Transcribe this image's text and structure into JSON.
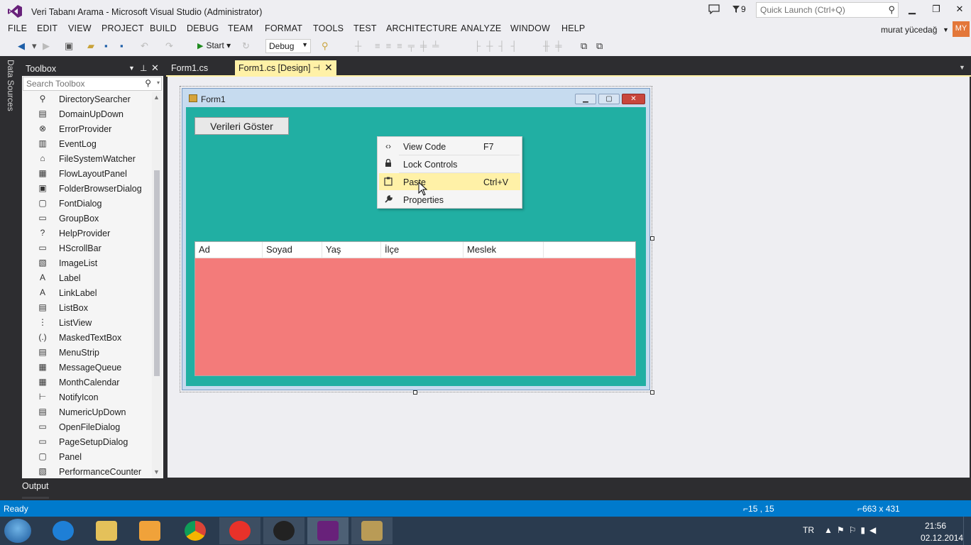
{
  "window": {
    "title": "Veri Tabanı Arama - Microsoft Visual Studio (Administrator)",
    "notification_count": "9",
    "quick_launch_placeholder": "Quick Launch (Ctrl+Q)"
  },
  "menu": {
    "items": [
      "FILE",
      "EDIT",
      "VIEW",
      "PROJECT",
      "BUILD",
      "DEBUG",
      "TEAM",
      "FORMAT",
      "TOOLS",
      "TEST",
      "ARCHITECTURE",
      "ANALYZE",
      "WINDOW",
      "HELP"
    ]
  },
  "user": {
    "name": "murat yücedağ",
    "initials": "MY"
  },
  "toolbar": {
    "start_label": "Start",
    "config_value": "Debug"
  },
  "side_strip": {
    "data_sources": "Data Sources"
  },
  "toolbox": {
    "title": "Toolbox",
    "search_placeholder": "Search Toolbox",
    "items": [
      {
        "label": "DirectorySearcher",
        "icon": "magnifier-icon"
      },
      {
        "label": "DomainUpDown",
        "icon": "updown-icon"
      },
      {
        "label": "ErrorProvider",
        "icon": "error-icon"
      },
      {
        "label": "EventLog",
        "icon": "eventlog-icon"
      },
      {
        "label": "FileSystemWatcher",
        "icon": "watcher-icon"
      },
      {
        "label": "FlowLayoutPanel",
        "icon": "flowlayout-icon"
      },
      {
        "label": "FolderBrowserDialog",
        "icon": "folder-icon"
      },
      {
        "label": "FontDialog",
        "icon": "font-icon"
      },
      {
        "label": "GroupBox",
        "icon": "groupbox-icon"
      },
      {
        "label": "HelpProvider",
        "icon": "help-icon"
      },
      {
        "label": "HScrollBar",
        "icon": "hscroll-icon"
      },
      {
        "label": "ImageList",
        "icon": "imagelist-icon"
      },
      {
        "label": "Label",
        "icon": "label-icon"
      },
      {
        "label": "LinkLabel",
        "icon": "linklabel-icon"
      },
      {
        "label": "ListBox",
        "icon": "listbox-icon"
      },
      {
        "label": "ListView",
        "icon": "listview-icon"
      },
      {
        "label": "MaskedTextBox",
        "icon": "masked-icon"
      },
      {
        "label": "MenuStrip",
        "icon": "menustrip-icon"
      },
      {
        "label": "MessageQueue",
        "icon": "queue-icon"
      },
      {
        "label": "MonthCalendar",
        "icon": "calendar-icon"
      },
      {
        "label": "NotifyIcon",
        "icon": "notify-icon"
      },
      {
        "label": "NumericUpDown",
        "icon": "numeric-icon"
      },
      {
        "label": "OpenFileDialog",
        "icon": "openfile-icon"
      },
      {
        "label": "PageSetupDialog",
        "icon": "pagesetup-icon"
      },
      {
        "label": "Panel",
        "icon": "panel-icon"
      },
      {
        "label": "PerformanceCounter",
        "icon": "perf-icon"
      }
    ],
    "glyphs": [
      "⚲",
      "▤",
      "⊗",
      "▥",
      "⌂",
      "▦",
      "▣",
      "▢",
      "▭",
      "?",
      "▭",
      "▧",
      "A",
      "A",
      "▤",
      "⋮",
      "(.)",
      "▤",
      "▦",
      "▦",
      "⊢",
      "▤",
      "▭",
      "▭",
      "▢",
      "▧"
    ]
  },
  "tabs": [
    {
      "label": "Form1.cs"
    },
    {
      "label": "Form1.cs [Design]"
    }
  ],
  "form": {
    "title": "Form1",
    "button_label": "Verileri Göster",
    "client_color": "#21afa3",
    "listview_color": "#f37b7a",
    "columns": [
      "Ad",
      "Soyad",
      "Yaş",
      "İlçe",
      "Meslek",
      ""
    ]
  },
  "context_menu": {
    "items": [
      {
        "label": "View Code",
        "shortcut": "F7",
        "icon": "code-icon",
        "glyph": "‹›"
      },
      {
        "label": "Lock Controls",
        "shortcut": "",
        "icon": "lock-icon",
        "glyph": "🔒"
      },
      {
        "label": "Paste",
        "shortcut": "Ctrl+V",
        "icon": "paste-icon",
        "glyph": "▢"
      },
      {
        "label": "Properties",
        "shortcut": "",
        "icon": "wrench-icon",
        "glyph": "🔧"
      }
    ]
  },
  "output": {
    "label": "Output"
  },
  "status": {
    "text": "Ready",
    "position": "15 , 15",
    "size": "663 x 431"
  },
  "taskbar": {
    "language": "TR",
    "time": "21:56",
    "date": "02.12.2014"
  },
  "colors": {
    "accent": "#007acc",
    "tab_active": "#fff1a7",
    "vs_purple": "#68217a"
  }
}
